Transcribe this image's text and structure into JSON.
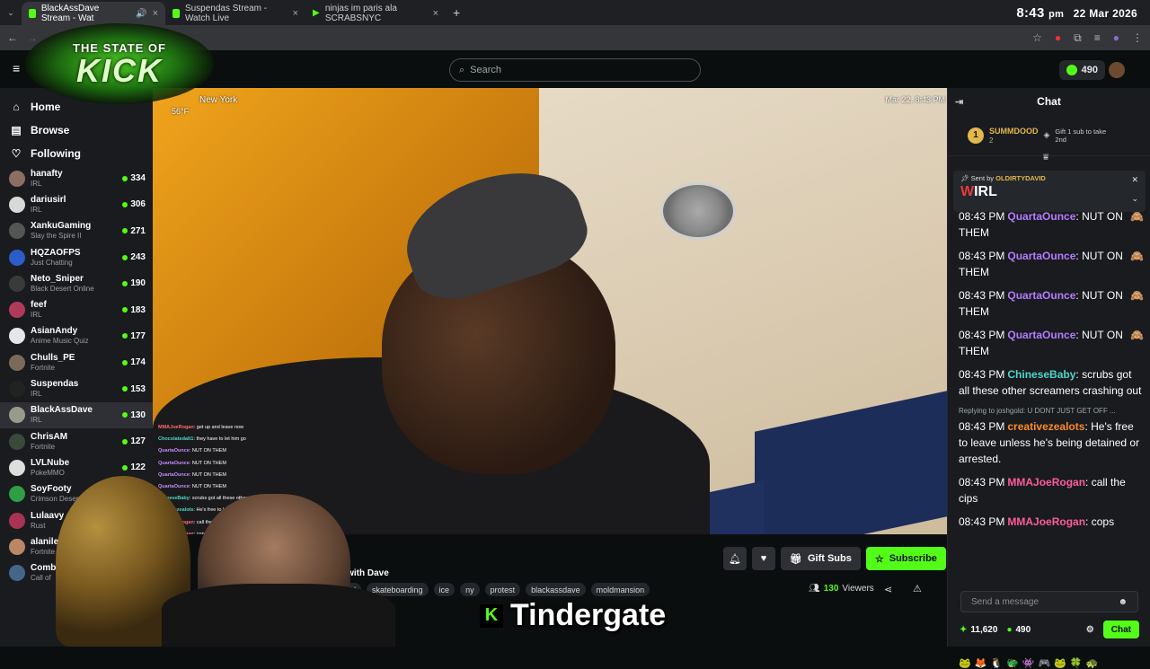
{
  "browser": {
    "tabs": [
      {
        "title": "BlackAssDave Stream - Wat",
        "active": true
      },
      {
        "title": "Suspendas Stream - Watch Live",
        "active": false
      },
      {
        "title": "ninjas im paris ala SCRABSNYC",
        "active": false
      }
    ],
    "clock": {
      "time": "8:43",
      "ampm": "pm",
      "date": "22 Mar 2026"
    }
  },
  "logo": {
    "line1": "THE STATE OF",
    "line2": "KICK"
  },
  "header": {
    "search_placeholder": "Search",
    "coins": "490"
  },
  "nav": {
    "home": "Home",
    "browse": "Browse",
    "following": "Following"
  },
  "channels": [
    {
      "name": "hanafty",
      "category": "IRL",
      "viewers": "334",
      "color": "#8d6e63"
    },
    {
      "name": "dariusirl",
      "category": "IRL",
      "viewers": "306",
      "color": "#d8d8d8"
    },
    {
      "name": "XankuGaming",
      "category": "Slay the Spire II",
      "viewers": "271",
      "color": "#555"
    },
    {
      "name": "HQZAOFPS",
      "category": "Just Chatting",
      "viewers": "243",
      "color": "#2b5cc8"
    },
    {
      "name": "Neto_Sniper",
      "category": "Black Desert Online",
      "viewers": "190",
      "color": "#3a3a3a"
    },
    {
      "name": "feef",
      "category": "IRL",
      "viewers": "183",
      "color": "#b03a5a"
    },
    {
      "name": "AsianAndy",
      "category": "Anime Music Quiz",
      "viewers": "177",
      "color": "#e6e6e6"
    },
    {
      "name": "Chulls_PE",
      "category": "Fortnite",
      "viewers": "174",
      "color": "#7a6a5a"
    },
    {
      "name": "Suspendas",
      "category": "IRL",
      "viewers": "153",
      "color": "#222"
    },
    {
      "name": "BlackAssDave",
      "category": "IRL",
      "viewers": "130",
      "color": "#9a9a8a",
      "active": true
    },
    {
      "name": "ChrisAM",
      "category": "Fortnite",
      "viewers": "127",
      "color": "#3a4a3a"
    },
    {
      "name": "LVLNube",
      "category": "PokeMMO",
      "viewers": "122",
      "color": "#dddddd"
    },
    {
      "name": "SoyFooty",
      "category": "Crimson Desert",
      "viewers": "",
      "color": "#2f9e44"
    },
    {
      "name": "Lulaavy",
      "category": "Rust",
      "viewers": "",
      "color": "#aa3355"
    },
    {
      "name": "alanilebab",
      "category": "Fortnite",
      "viewers": "",
      "color": "#bb8866"
    },
    {
      "name": "Comb",
      "category": "Call of",
      "viewers": "",
      "color": "#446688"
    }
  ],
  "video": {
    "location": "New York",
    "temp": "56°F",
    "date": "Mar 22, 8:43 PM",
    "overlay_chat": [
      {
        "user": "MMAJoeRogan",
        "text": "get up and leave now"
      },
      {
        "user": "Chocolatedalt1",
        "text": "they have to let him go"
      },
      {
        "user": "QuartaOunce",
        "text": "NUT ON THEM"
      },
      {
        "user": "QuartaOunce",
        "text": "NUT ON THEM"
      },
      {
        "user": "QuartaOunce",
        "text": "NUT ON THEM"
      },
      {
        "user": "QuartaOunce",
        "text": "NUT ON THEM"
      },
      {
        "user": "ChineseBaby",
        "text": "scrubs got all these other scr"
      },
      {
        "user": "creativezealots",
        "text": "He's free to leave ... arrested."
      },
      {
        "user": "MMAJoeRogan",
        "text": "call the cips"
      },
      {
        "user": "MMAJoeRogan",
        "text": "cops"
      }
    ]
  },
  "stream": {
    "title": "PS with Dave",
    "tags": [
      "irl",
      "skateboarding",
      "ice",
      "ny",
      "protest",
      "blackassdave",
      "moldmansion"
    ],
    "viewers": "130",
    "viewers_label": "Viewers",
    "gift_label": "Gift Subs",
    "subscribe_label": "Subscribe"
  },
  "caption": "Tindergate",
  "chat": {
    "title": "Chat",
    "leader": {
      "rank": "1",
      "name": "SUMMDOOD",
      "count": "2",
      "gift": "Gift 1 sub to take 2nd"
    },
    "pinned": {
      "sent_by": "Sent by",
      "user": "OLDIRTYDAVID",
      "prefix": "W",
      "text": "IRL"
    },
    "messages": [
      {
        "time": "08:43 PM",
        "user": "QuartaOunce",
        "color": "#b57cff",
        "text": "NUT ON THEM"
      },
      {
        "time": "08:43 PM",
        "user": "QuartaOunce",
        "color": "#b57cff",
        "text": "NUT ON THEM"
      },
      {
        "time": "08:43 PM",
        "user": "QuartaOunce",
        "color": "#b57cff",
        "text": "NUT ON THEM"
      },
      {
        "time": "08:43 PM",
        "user": "QuartaOunce",
        "color": "#b57cff",
        "text": "NUT ON THEM"
      },
      {
        "time": "08:43 PM",
        "user": "ChineseBaby",
        "color": "#4fd6c9",
        "text": "scrubs got all these other screamers crashing out"
      },
      {
        "reply": "Replying to joshgold: U DONT JUST GET OFF ...",
        "time": "08:43 PM",
        "user": "creativezealots",
        "color": "#ff8a2a",
        "text": "He's free to leave unless he's being detained or arrested."
      },
      {
        "time": "08:43 PM",
        "user": "MMAJoeRogan",
        "color": "#ff5c9c",
        "text": "call the cips"
      },
      {
        "time": "08:43 PM",
        "user": "MMAJoeRogan",
        "color": "#ff5c9c",
        "text": "cops"
      }
    ],
    "send_placeholder": "Send a message",
    "points": "11,620",
    "coins": "490",
    "chat_button": "Chat"
  }
}
